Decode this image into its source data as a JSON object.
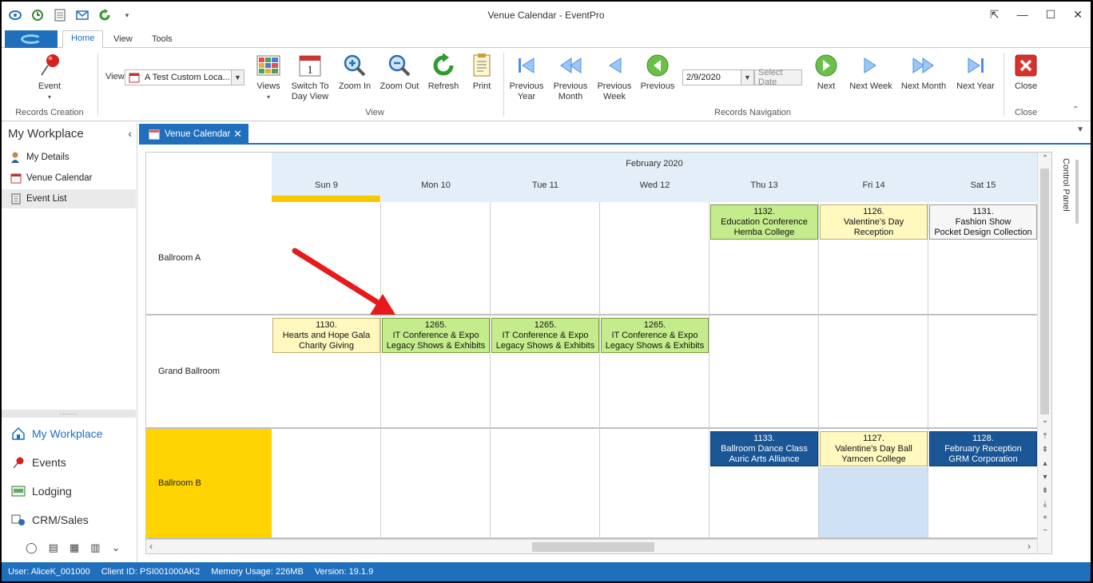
{
  "window": {
    "title": "Venue Calendar - EventPro"
  },
  "ribbon_tabs": [
    "Home",
    "View",
    "Tools"
  ],
  "ribbon": {
    "event_label": "Event",
    "records_creation_label": "Records Creation",
    "view_label": "View",
    "view_combo_value": "A Test Custom Loca...",
    "views_label": "Views",
    "switch_label_1": "Switch To",
    "switch_label_2": "Day View",
    "zoom_in": "Zoom In",
    "zoom_out": "Zoom Out",
    "refresh": "Refresh",
    "print": "Print",
    "view_group": "View",
    "prev_year_1": "Previous",
    "prev_year_2": "Year",
    "prev_month_1": "Previous",
    "prev_month_2": "Month",
    "prev_week_1": "Previous",
    "prev_week_2": "Week",
    "previous": "Previous",
    "date_value": "2/9/2020",
    "select_date": "Select Date",
    "next": "Next",
    "next_week": "Next Week",
    "next_month": "Next Month",
    "next_year": "Next Year",
    "records_nav_group": "Records Navigation",
    "close": "Close",
    "close_group": "Close"
  },
  "nav": {
    "title": "My Workplace",
    "items": [
      "My Details",
      "Venue Calendar",
      "Event List"
    ],
    "sections": [
      "My Workplace",
      "Events",
      "Lodging",
      "CRM/Sales"
    ]
  },
  "doc_tab": {
    "label": "Venue Calendar"
  },
  "calendar": {
    "month": "February 2020",
    "days": [
      "Sun 9",
      "Mon 10",
      "Tue 11",
      "Wed 12",
      "Thu 13",
      "Fri 14",
      "Sat 15"
    ],
    "resources": [
      "Ballroom A",
      "Grand Ballroom",
      "Ballroom B"
    ],
    "events": [
      {
        "id": "1132.",
        "line1": "Education Conference",
        "line2": "Hemba College",
        "row": 0,
        "col": 4,
        "color": "green"
      },
      {
        "id": "1126.",
        "line1": "Valentine's Day",
        "line2": "Reception",
        "row": 0,
        "col": 5,
        "color": "yellow"
      },
      {
        "id": "1131.",
        "line1": "Fashion Show",
        "line2": "Pocket Design Collection",
        "row": 0,
        "col": 6,
        "color": "white"
      },
      {
        "id": "1130.",
        "line1": "Hearts and Hope Gala",
        "line2": "Charity Giving",
        "row": 1,
        "col": 0,
        "color": "yellow"
      },
      {
        "id": "1265.",
        "line1": "IT Conference & Expo",
        "line2": "Legacy Shows & Exhibits",
        "row": 1,
        "col": 1,
        "color": "green"
      },
      {
        "id": "1265.",
        "line1": "IT Conference & Expo",
        "line2": "Legacy Shows & Exhibits",
        "row": 1,
        "col": 2,
        "color": "green"
      },
      {
        "id": "1265.",
        "line1": "IT Conference & Expo",
        "line2": "Legacy Shows & Exhibits",
        "row": 1,
        "col": 3,
        "color": "green"
      },
      {
        "id": "1133.",
        "line1": "Ballroom Dance Class",
        "line2": "Auric Arts Alliance",
        "row": 2,
        "col": 4,
        "color": "blue"
      },
      {
        "id": "1127.",
        "line1": "Valentine's Day Ball",
        "line2": "Yarncen College",
        "row": 2,
        "col": 5,
        "color": "yellow"
      },
      {
        "id": "1128.",
        "line1": "February Reception",
        "line2": "GRM Corporation",
        "row": 2,
        "col": 6,
        "color": "blue"
      }
    ]
  },
  "control_panel": "Control Panel",
  "status": {
    "user": "User: AliceK_001000",
    "client": "Client ID: PSI001000AK2",
    "memory": "Memory Usage: 226MB",
    "version": "Version: 19.1.9"
  },
  "colors": {
    "accent": "#1f6fbd",
    "today": "#f5c800",
    "arrow": "#e8191b"
  }
}
